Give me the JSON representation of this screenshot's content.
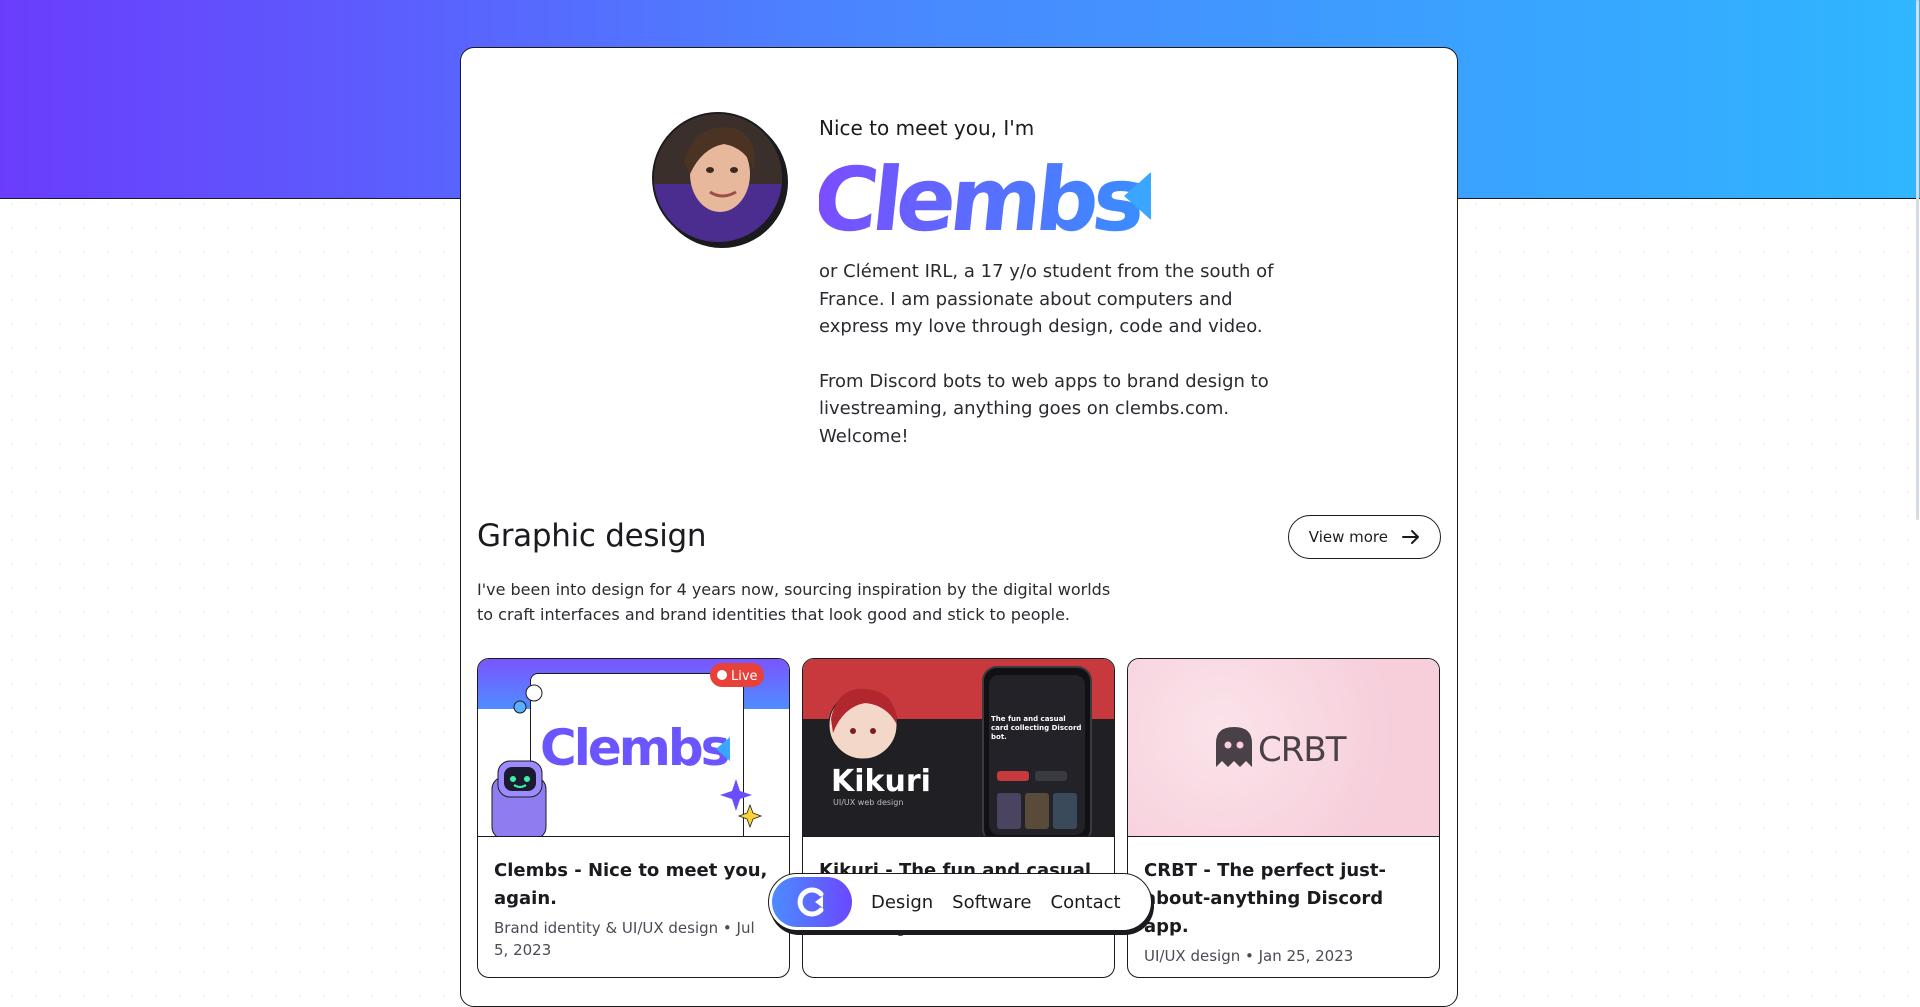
{
  "intro": {
    "greeting": "Nice to meet you, I'm",
    "name_logo": "Clembs",
    "bio_1": "or Clément IRL, a 17 y/o student from the south of France. I am passionate about computers and express my love through design, code and video.",
    "bio_2": "From Discord bots to web apps to brand design to livestreaming, anything goes on clembs.com. Welcome!"
  },
  "graphic_design": {
    "title": "Graphic design",
    "description": "I've been into design for 4 years now, sourcing inspiration by the digital worlds to craft interfaces and brand identities that look good and stick to people.",
    "view_more_label": "View more",
    "projects": [
      {
        "title": "Clembs - Nice to meet you, again.",
        "meta": "Brand identity & UI/UX design • Jul 5, 2023",
        "thumb_logo": "Clembs",
        "thumb_badge": "Live"
      },
      {
        "title": "Kikuri - The fun and casual card",
        "meta": "UI/UX design",
        "thumb_title": "Kikuri",
        "thumb_subtitle": "UI/UX web design",
        "thumb_phone_text": "The fun and casual card collecting Discord bot."
      },
      {
        "title": "CRBT - The perfect just-about-anything Discord app.",
        "meta": "UI/UX design • Jan 25, 2023",
        "thumb_logo": "CRBT"
      }
    ]
  },
  "dock": {
    "links": [
      "Design",
      "Software",
      "Contact"
    ]
  },
  "colors": {
    "gradient_start": "#6a3dfc",
    "gradient_end": "#2fb6ff",
    "ink": "#1b1b1f"
  }
}
